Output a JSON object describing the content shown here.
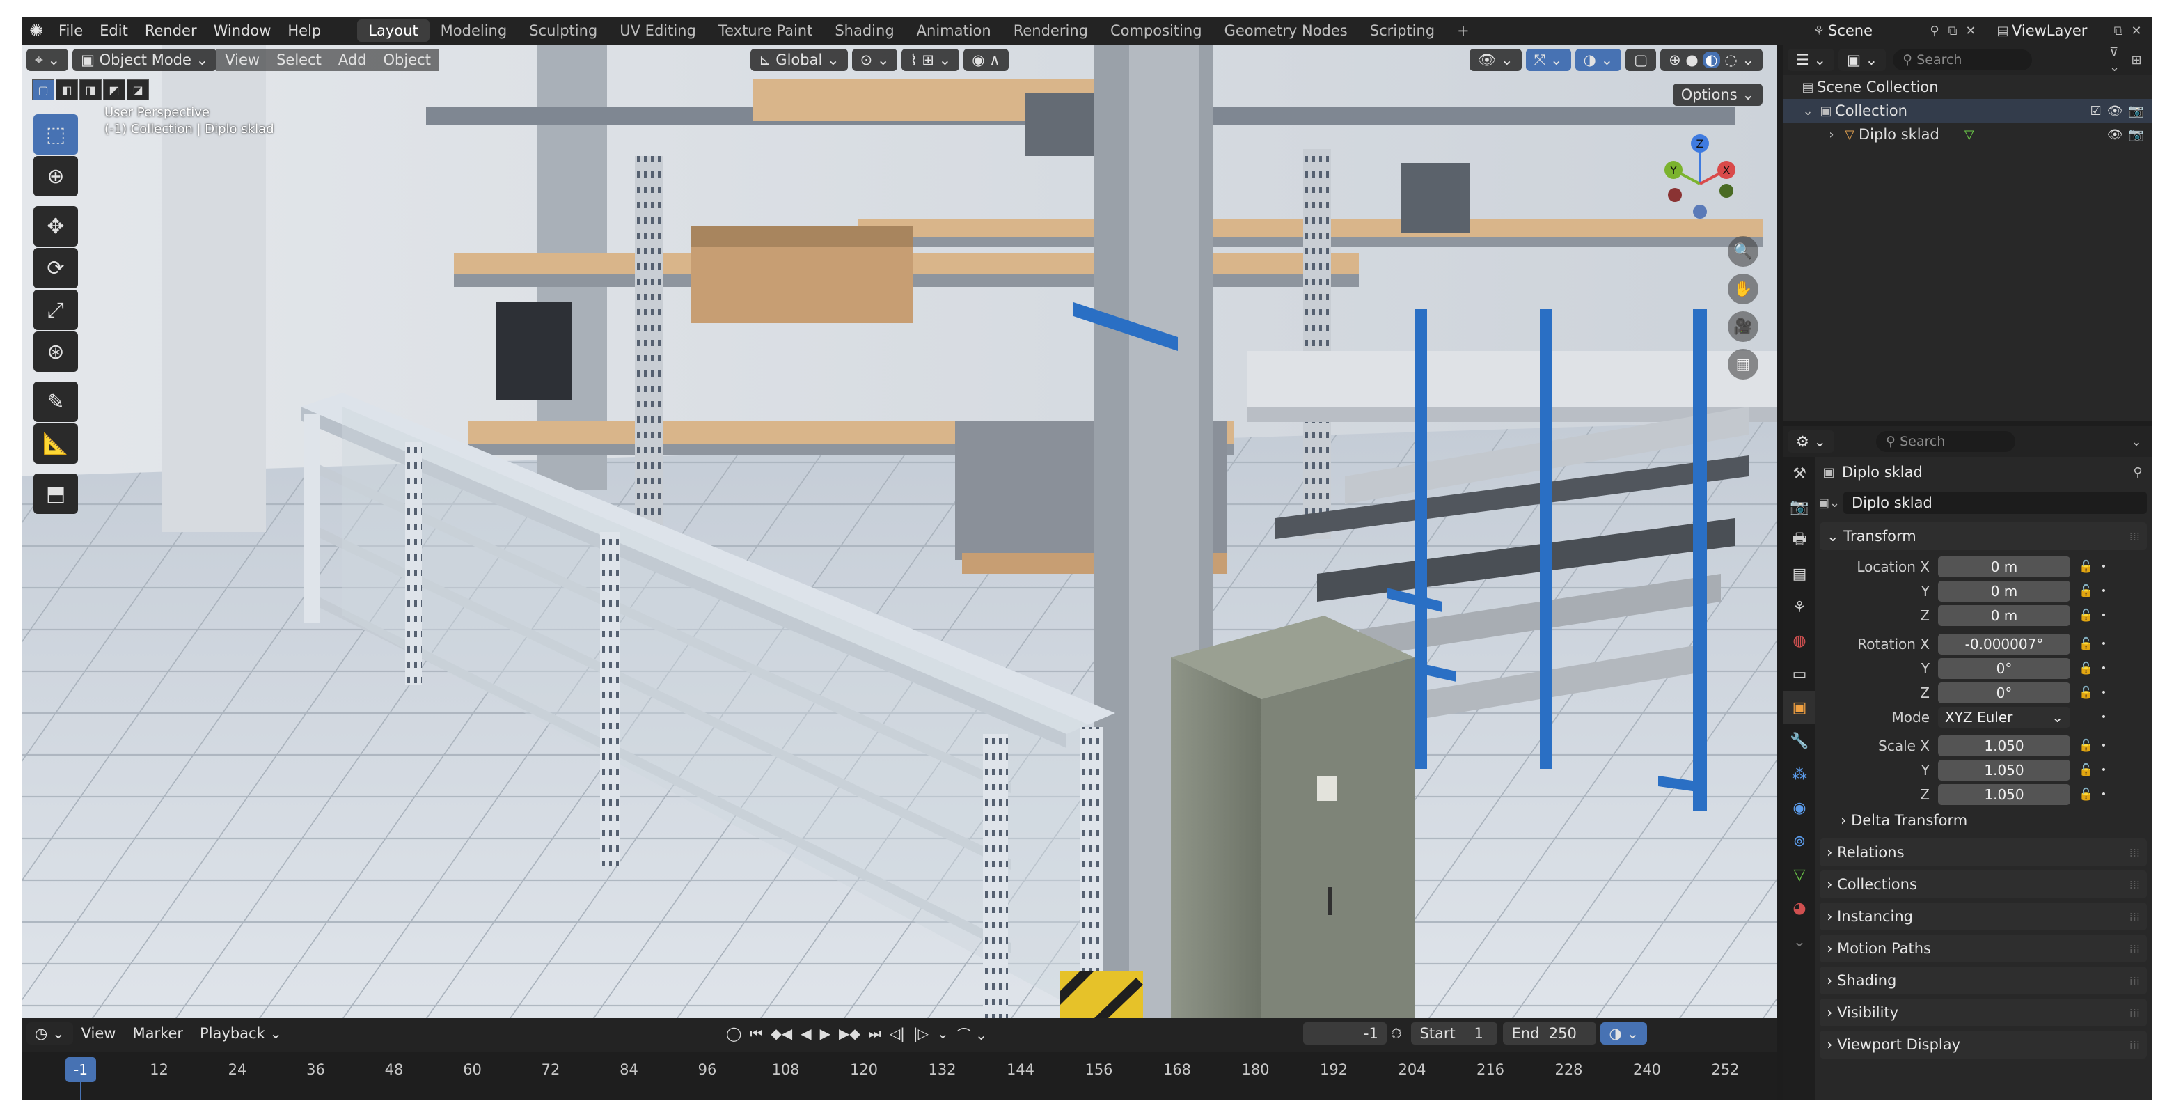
{
  "topbar": {
    "menus": [
      "File",
      "Edit",
      "Render",
      "Window",
      "Help"
    ],
    "workspaces": [
      "Layout",
      "Modeling",
      "Sculpting",
      "UV Editing",
      "Texture Paint",
      "Shading",
      "Animation",
      "Rendering",
      "Compositing",
      "Geometry Nodes",
      "Scripting"
    ],
    "add_tab": "+",
    "scene": "Scene",
    "view_layer": "ViewLayer"
  },
  "viewport": {
    "mode": "Object Mode",
    "menus": [
      "View",
      "Select",
      "Add",
      "Object"
    ],
    "transform_orientation": "Global",
    "overlay_line1": "User Perspective",
    "overlay_line2": "(-1) Collection | Diplo sklad",
    "options": "Options",
    "gizmo": {
      "z": "Z",
      "y": "Y",
      "x": "X"
    }
  },
  "timeline": {
    "menus": [
      "View",
      "Marker",
      "Playback"
    ],
    "current_frame": "-1",
    "start_label": "Start",
    "start": "1",
    "end_label": "End",
    "end": "250",
    "ticks": [
      "-1",
      "12",
      "24",
      "36",
      "48",
      "60",
      "72",
      "84",
      "96",
      "108",
      "120",
      "132",
      "144",
      "156",
      "168",
      "180",
      "192",
      "204",
      "216",
      "228",
      "240",
      "252"
    ]
  },
  "outliner": {
    "search_placeholder": "Search",
    "scene_collection": "Scene Collection",
    "collection": "Collection",
    "object": "Diplo sklad"
  },
  "properties": {
    "search_placeholder": "Search",
    "object_title": "Diplo sklad",
    "object_name": "Diplo sklad",
    "transform_header": "Transform",
    "location": {
      "label_x": "Location X",
      "label_y": "Y",
      "label_z": "Z",
      "x": "0 m",
      "y": "0 m",
      "z": "0 m"
    },
    "rotation": {
      "label_x": "Rotation X",
      "label_y": "Y",
      "label_z": "Z",
      "x": "-0.000007°",
      "y": "0°",
      "z": "0°"
    },
    "mode_label": "Mode",
    "mode": "XYZ Euler",
    "scale": {
      "label_x": "Scale X",
      "label_y": "Y",
      "label_z": "Z",
      "x": "1.050",
      "y": "1.050",
      "z": "1.050"
    },
    "delta_transform": "Delta Transform",
    "panels": [
      "Relations",
      "Collections",
      "Instancing",
      "Motion Paths",
      "Shading",
      "Visibility",
      "Viewport Display"
    ]
  },
  "colors": {
    "accent": "#4772b3",
    "axis_x": "#d94a4a",
    "axis_y": "#7bb32e",
    "axis_z": "#3f7be0",
    "rack_blue": "#2a6fc4",
    "wood": "#d9b58a"
  }
}
